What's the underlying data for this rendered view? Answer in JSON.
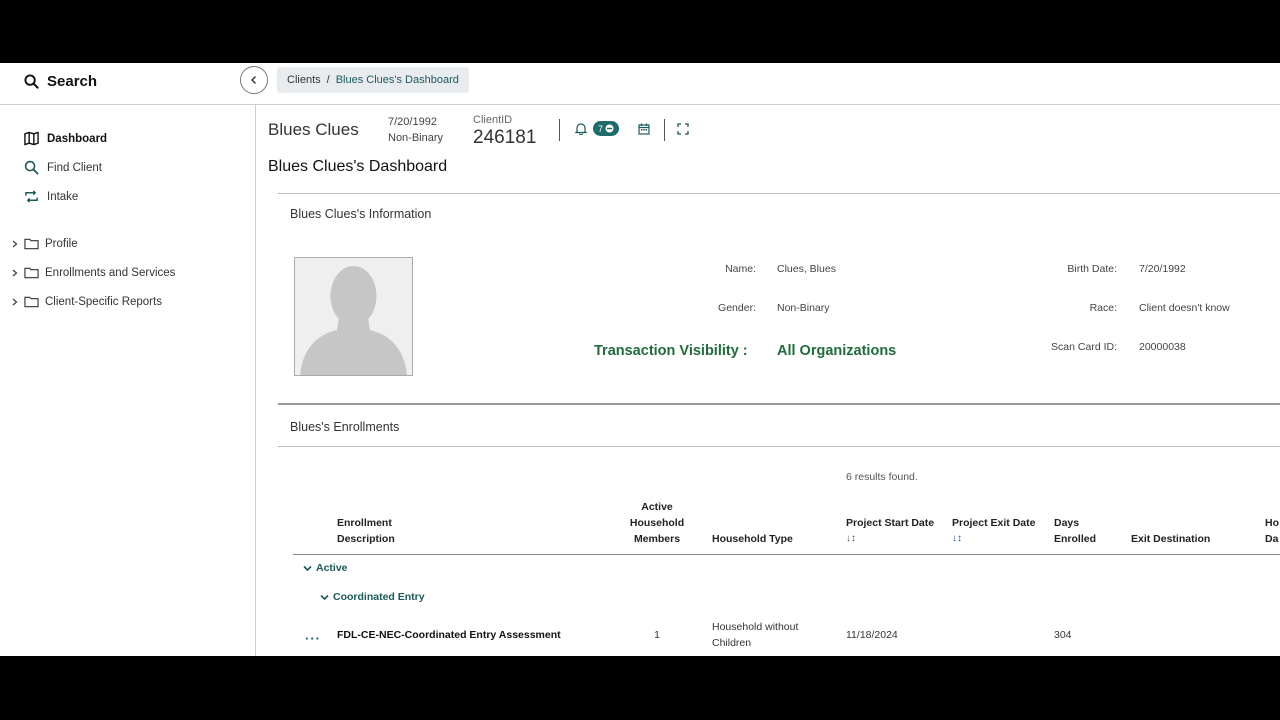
{
  "topbar": {
    "search_label": "Search",
    "breadcrumb": {
      "root": "Clients",
      "separator": "/",
      "current": "Blues Clues's Dashboard"
    }
  },
  "sidebar": {
    "items": [
      {
        "label": "Dashboard",
        "icon": "map-icon",
        "active": true
      },
      {
        "label": "Find Client",
        "icon": "search-icon"
      },
      {
        "label": "Intake",
        "icon": "repeat-icon"
      }
    ],
    "tree": [
      {
        "label": "Profile",
        "icon": "folder-icon"
      },
      {
        "label": "Enrollments and Services",
        "icon": "folder-icon"
      },
      {
        "label": "Client-Specific Reports",
        "icon": "folder-icon"
      }
    ]
  },
  "client": {
    "name": "Blues Clues",
    "dob": "7/20/1992",
    "gender": "Non-Binary",
    "id_label": "ClientID",
    "id": "246181",
    "badge_count": "7"
  },
  "dashboard_title": "Blues Clues's Dashboard",
  "info": {
    "section_title": "Blues Clues's Information",
    "name_label": "Name:",
    "name_value": "Clues, Blues",
    "gender_label": "Gender:",
    "gender_value": "Non-Binary",
    "birth_label": "Birth Date:",
    "birth_value": "7/20/1992",
    "race_label": "Race:",
    "race_value": "Client doesn't know",
    "scan_label": "Scan Card ID:",
    "scan_value": "20000038",
    "visibility_label": "Transaction Visibility :",
    "visibility_value": "All Organizations"
  },
  "enrollments": {
    "section_title": "Blues's Enrollments",
    "results": "6 results found.",
    "headers": {
      "description": [
        "Enrollment",
        "Description"
      ],
      "members": [
        "Active",
        "Household",
        "Members"
      ],
      "household_type": "Household Type",
      "start": "Project Start Date",
      "exit": "Project Exit Date",
      "days": [
        "Days",
        "Enrolled"
      ],
      "destination": "Exit Destination",
      "cut": [
        "Ho",
        "Da"
      ]
    },
    "group_active": "Active",
    "group_ce": "Coordinated Entry",
    "rows": [
      {
        "description": "FDL-CE-NEC-Coordinated Entry Assessment",
        "members": "1",
        "household_type": [
          "Household without",
          "Children"
        ],
        "start": "11/18/2024",
        "days": "304"
      }
    ]
  }
}
